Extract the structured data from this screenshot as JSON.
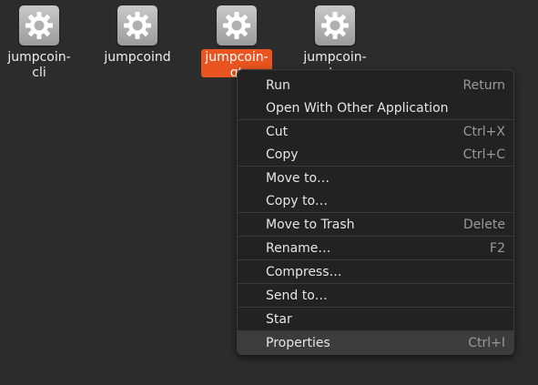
{
  "desktop": {
    "icons": [
      {
        "label": "jumpcoin-cli",
        "icon": "gear-icon"
      },
      {
        "label": "jumpcoind",
        "icon": "gear-icon"
      },
      {
        "label": "jumpcoin-qt",
        "icon": "gear-icon",
        "selected": true
      },
      {
        "label": "jumpcoin-tx",
        "icon": "gear-icon"
      }
    ]
  },
  "context_menu": {
    "run": {
      "label": "Run",
      "shortcut": "Return"
    },
    "open_with": {
      "label": "Open With Other Application"
    },
    "cut": {
      "label": "Cut",
      "shortcut": "Ctrl+X"
    },
    "copy": {
      "label": "Copy",
      "shortcut": "Ctrl+C"
    },
    "move_to": {
      "label": "Move to…"
    },
    "copy_to": {
      "label": "Copy to…"
    },
    "move_to_trash": {
      "label": "Move to Trash",
      "shortcut": "Delete"
    },
    "rename": {
      "label": "Rename…",
      "shortcut": "F2"
    },
    "compress": {
      "label": "Compress…"
    },
    "send_to": {
      "label": "Send to…"
    },
    "star": {
      "label": "Star"
    },
    "properties": {
      "label": "Properties",
      "shortcut": "Ctrl+I"
    }
  },
  "colors": {
    "selection_accent": "#e95420",
    "background": "#2c2c2c",
    "menu_background": "#222222"
  }
}
